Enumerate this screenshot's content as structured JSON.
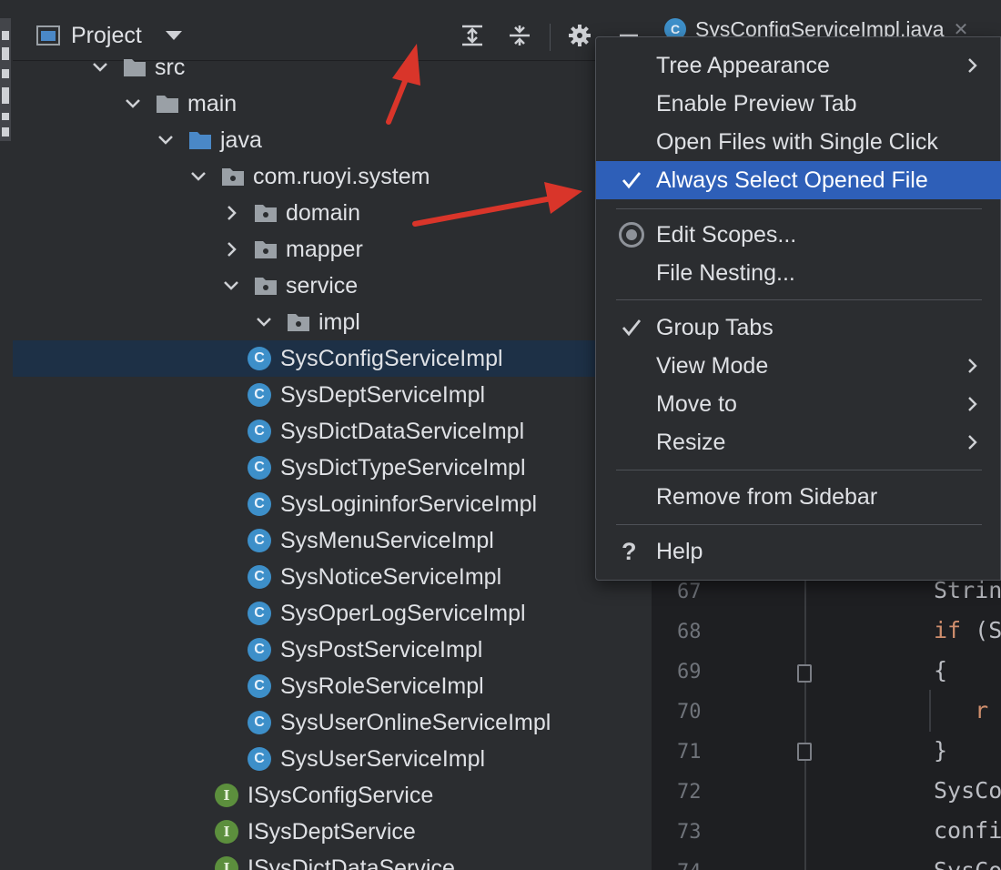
{
  "panel": {
    "title": "Project"
  },
  "tree": [
    {
      "label": "src",
      "kind": "folder",
      "expanded": true
    },
    {
      "label": "main",
      "kind": "folder",
      "expanded": true
    },
    {
      "label": "java",
      "kind": "source-folder",
      "expanded": true
    },
    {
      "label": "com.ruoyi.system",
      "kind": "package",
      "expanded": true
    },
    {
      "label": "domain",
      "kind": "package",
      "expanded": false
    },
    {
      "label": "mapper",
      "kind": "package",
      "expanded": false
    },
    {
      "label": "service",
      "kind": "package",
      "expanded": true
    },
    {
      "label": "impl",
      "kind": "package",
      "expanded": true
    },
    {
      "label": "SysConfigServiceImpl",
      "kind": "class",
      "selected": true
    },
    {
      "label": "SysDeptServiceImpl",
      "kind": "class"
    },
    {
      "label": "SysDictDataServiceImpl",
      "kind": "class"
    },
    {
      "label": "SysDictTypeServiceImpl",
      "kind": "class"
    },
    {
      "label": "SysLogininforServiceImpl",
      "kind": "class"
    },
    {
      "label": "SysMenuServiceImpl",
      "kind": "class"
    },
    {
      "label": "SysNoticeServiceImpl",
      "kind": "class"
    },
    {
      "label": "SysOperLogServiceImpl",
      "kind": "class"
    },
    {
      "label": "SysPostServiceImpl",
      "kind": "class"
    },
    {
      "label": "SysRoleServiceImpl",
      "kind": "class"
    },
    {
      "label": "SysUserOnlineServiceImpl",
      "kind": "class"
    },
    {
      "label": "SysUserServiceImpl",
      "kind": "class"
    },
    {
      "label": "ISysConfigService",
      "kind": "interface"
    },
    {
      "label": "ISysDeptService",
      "kind": "interface"
    },
    {
      "label": "ISysDictDataService",
      "kind": "interface"
    }
  ],
  "editor": {
    "tab_label": "SysConfigServiceImpl.java",
    "lines": [
      {
        "no": "67",
        "code": "Strin"
      },
      {
        "no": "68",
        "code": "if (S"
      },
      {
        "no": "69",
        "code": "{"
      },
      {
        "no": "70",
        "code": "    r"
      },
      {
        "no": "71",
        "code": "}"
      },
      {
        "no": "72",
        "code": "SysCo"
      },
      {
        "no": "73",
        "code": "confi"
      },
      {
        "no": "74",
        "code": "SysCo"
      }
    ]
  },
  "menu": {
    "items": [
      {
        "label": "Tree Appearance",
        "submenu": true
      },
      {
        "label": "Enable Preview Tab"
      },
      {
        "label": "Open Files with Single Click"
      },
      {
        "label": "Always Select Opened File",
        "checked": true,
        "active": true
      },
      {
        "label": "Edit Scopes...",
        "icon": "radio-icon"
      },
      {
        "label": "File Nesting..."
      },
      {
        "label": "Group Tabs",
        "checked": true
      },
      {
        "label": "View Mode",
        "submenu": true
      },
      {
        "label": "Move to",
        "submenu": true
      },
      {
        "label": "Resize",
        "submenu": true
      },
      {
        "label": "Remove from Sidebar"
      },
      {
        "label": "Help",
        "icon": "help-icon"
      }
    ]
  },
  "colors": {
    "panel_bg": "#2b2d30",
    "editor_bg": "#1e1f22",
    "selection": "#1d3046",
    "menu_active": "#2e5fb8",
    "annotation_arrow": "#d9352a"
  },
  "icons": {
    "help_glyph": "?",
    "class_glyph": "C",
    "interface_glyph": "I"
  }
}
